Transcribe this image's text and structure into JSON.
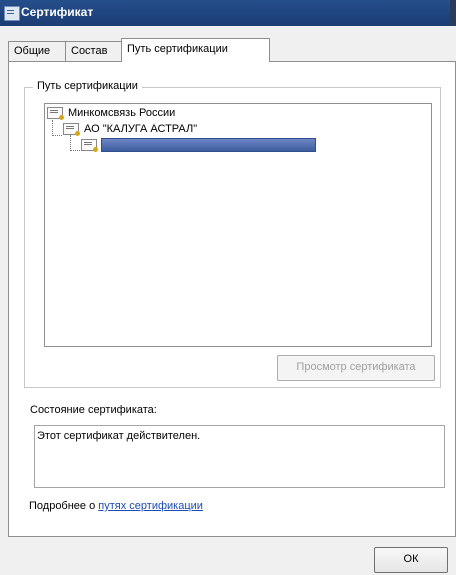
{
  "window": {
    "title": "Сертификат"
  },
  "tabs": [
    {
      "label": "Общие"
    },
    {
      "label": "Состав"
    },
    {
      "label": "Путь сертификации"
    }
  ],
  "path_group": {
    "label": "Путь сертификации",
    "tree": [
      {
        "label": "Минкомсвязь России"
      },
      {
        "label": "АО \"КАЛУГА АСТРАЛ\""
      },
      {
        "label": ""
      }
    ],
    "view_button": "Просмотр сертификата"
  },
  "status": {
    "label": "Состояние сертификата:",
    "text": "Этот сертификат действителен."
  },
  "more_info": {
    "prefix": "Подробнее о ",
    "link": "путях сертификации"
  },
  "buttons": {
    "ok": "ОК"
  }
}
